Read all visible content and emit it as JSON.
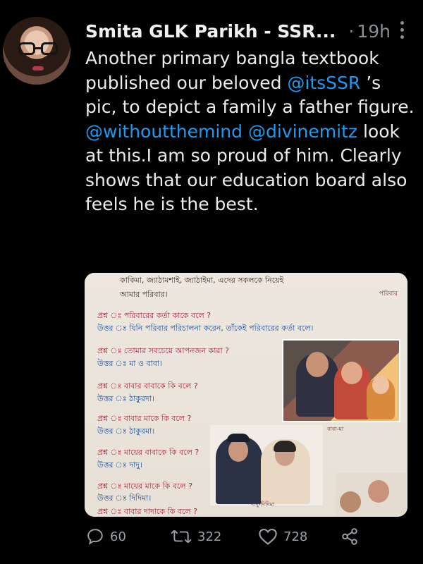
{
  "tweet": {
    "author": "Smita GLK Parikh - SSR...",
    "separator": "·",
    "time": "19h",
    "text_parts": [
      "Another primary bangla textbook published our beloved ",
      "@itsSSR",
      " ’s pic, to depict a family a father figure. ",
      "@withoutthemind",
      " ",
      "@divinemitz",
      " look at this.I am so proud of him. Clearly shows that our education board also feels he is the best."
    ]
  },
  "media": {
    "top_line": "কাকিমা, জ্যাঠামশাই, জ্যাঠাইমা, এদের সকলকে নিয়েই",
    "top_line2": "আমার পরিবার।",
    "corner_tag": "পরিবার",
    "qa": [
      {
        "q": "প্রশ্ন ঃ পরিবারের কর্তা কাকে বলে ?",
        "a": "উত্তর ঃ যিনি পরিবার পরিচালনা করেন, তাঁকেই পরিবারের কর্তা বলে।"
      },
      {
        "q": "প্রশ্ন ঃ তোমার সবচেয়ে আপনজন কারা ?",
        "a": "উত্তর ঃ মা ও বাবা।"
      },
      {
        "q": "প্রশ্ন ঃ বাবার বাবাকে কি বলে ?",
        "a": "উত্তর ঃ ঠাকুরদা।"
      },
      {
        "q": "প্রশ্ন ঃ বাবার মাকে কি বলে ?",
        "a": "উত্তর ঃ ঠাকুরমা।"
      },
      {
        "q": "প্রশ্ন ঃ মায়ের বাবাকে কি বলে ?",
        "a": "উত্তর ঃ দাদু।"
      },
      {
        "q": "প্রশ্ন ঃ মায়ের মাকে কি বলে ?",
        "a": "উত্তর ঃ দিদিমা।"
      },
      {
        "q": "প্রশ্ন ঃ বাবার দাদাকে কি বলে ?",
        "a": ""
      }
    ],
    "caption_family": "বাবা-মা",
    "caption_elders": "দাদু-দিদিমা"
  },
  "actions": {
    "reply_count": "60",
    "retweet_count": "322",
    "like_count": "728"
  },
  "colors": {
    "background": "#000000",
    "text": "#e7e9ea",
    "link": "#1d9bf0",
    "muted": "#8b8f94"
  }
}
